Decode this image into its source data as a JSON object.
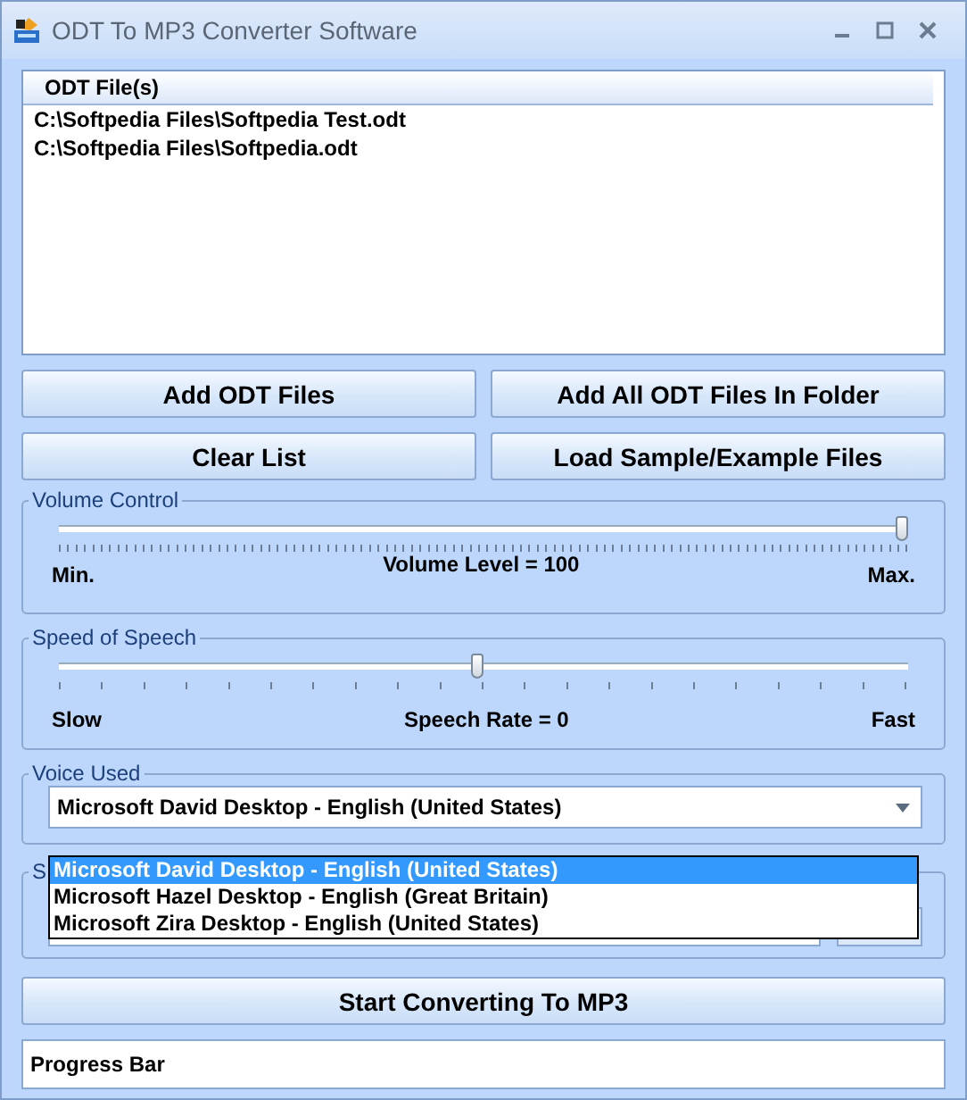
{
  "window": {
    "title": "ODT To MP3 Converter Software"
  },
  "file_list": {
    "column": "ODT File(s)",
    "rows": [
      "C:\\Softpedia Files\\Softpedia Test.odt",
      "C:\\Softpedia Files\\Softpedia.odt"
    ]
  },
  "buttons": [
    "Add ODT Files",
    "Add All ODT Files In Folder",
    "Clear List",
    "Load Sample/Example Files"
  ],
  "volume": {
    "title": "Volume Control",
    "level": 1,
    "min_label": "Min.",
    "reading": "Volume Level = 100",
    "max_label": "Max."
  },
  "speed": {
    "title": "Speed of Speech",
    "level": 0.5,
    "min_label": "Slow",
    "reading": "Speech Rate = 0",
    "max_label": "Fast"
  },
  "voice": {
    "title": "Voice Used",
    "value": "Microsoft David Desktop - English (United States)",
    "options": [
      {
        "label": "Microsoft David Desktop - English (United States)",
        "selected": true
      },
      {
        "label": "Microsoft Hazel Desktop - English (Great Britain)",
        "selected": false
      },
      {
        "label": "Microsoft Zira Desktop - English (United States)",
        "selected": false
      }
    ]
  },
  "output_group": {
    "title": "S"
  },
  "start_button": "Start Converting To MP3",
  "progress": {
    "label": "Progress Bar",
    "level": 0
  }
}
